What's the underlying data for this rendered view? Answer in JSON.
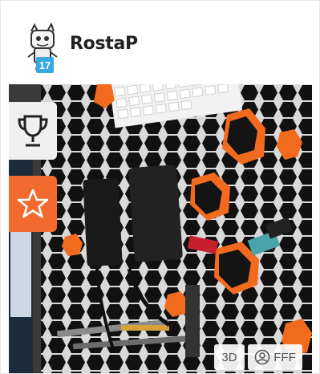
{
  "user": {
    "name": "RostaP",
    "level": "17"
  },
  "badges": {
    "three_d": "3D",
    "material": "FFF"
  },
  "icons": {
    "trophy": "trophy-icon",
    "star": "star-icon",
    "user_circle": "user-circle-icon"
  },
  "colors": {
    "accent": "#f26a2e",
    "level_badge": "#3aa7e0"
  }
}
